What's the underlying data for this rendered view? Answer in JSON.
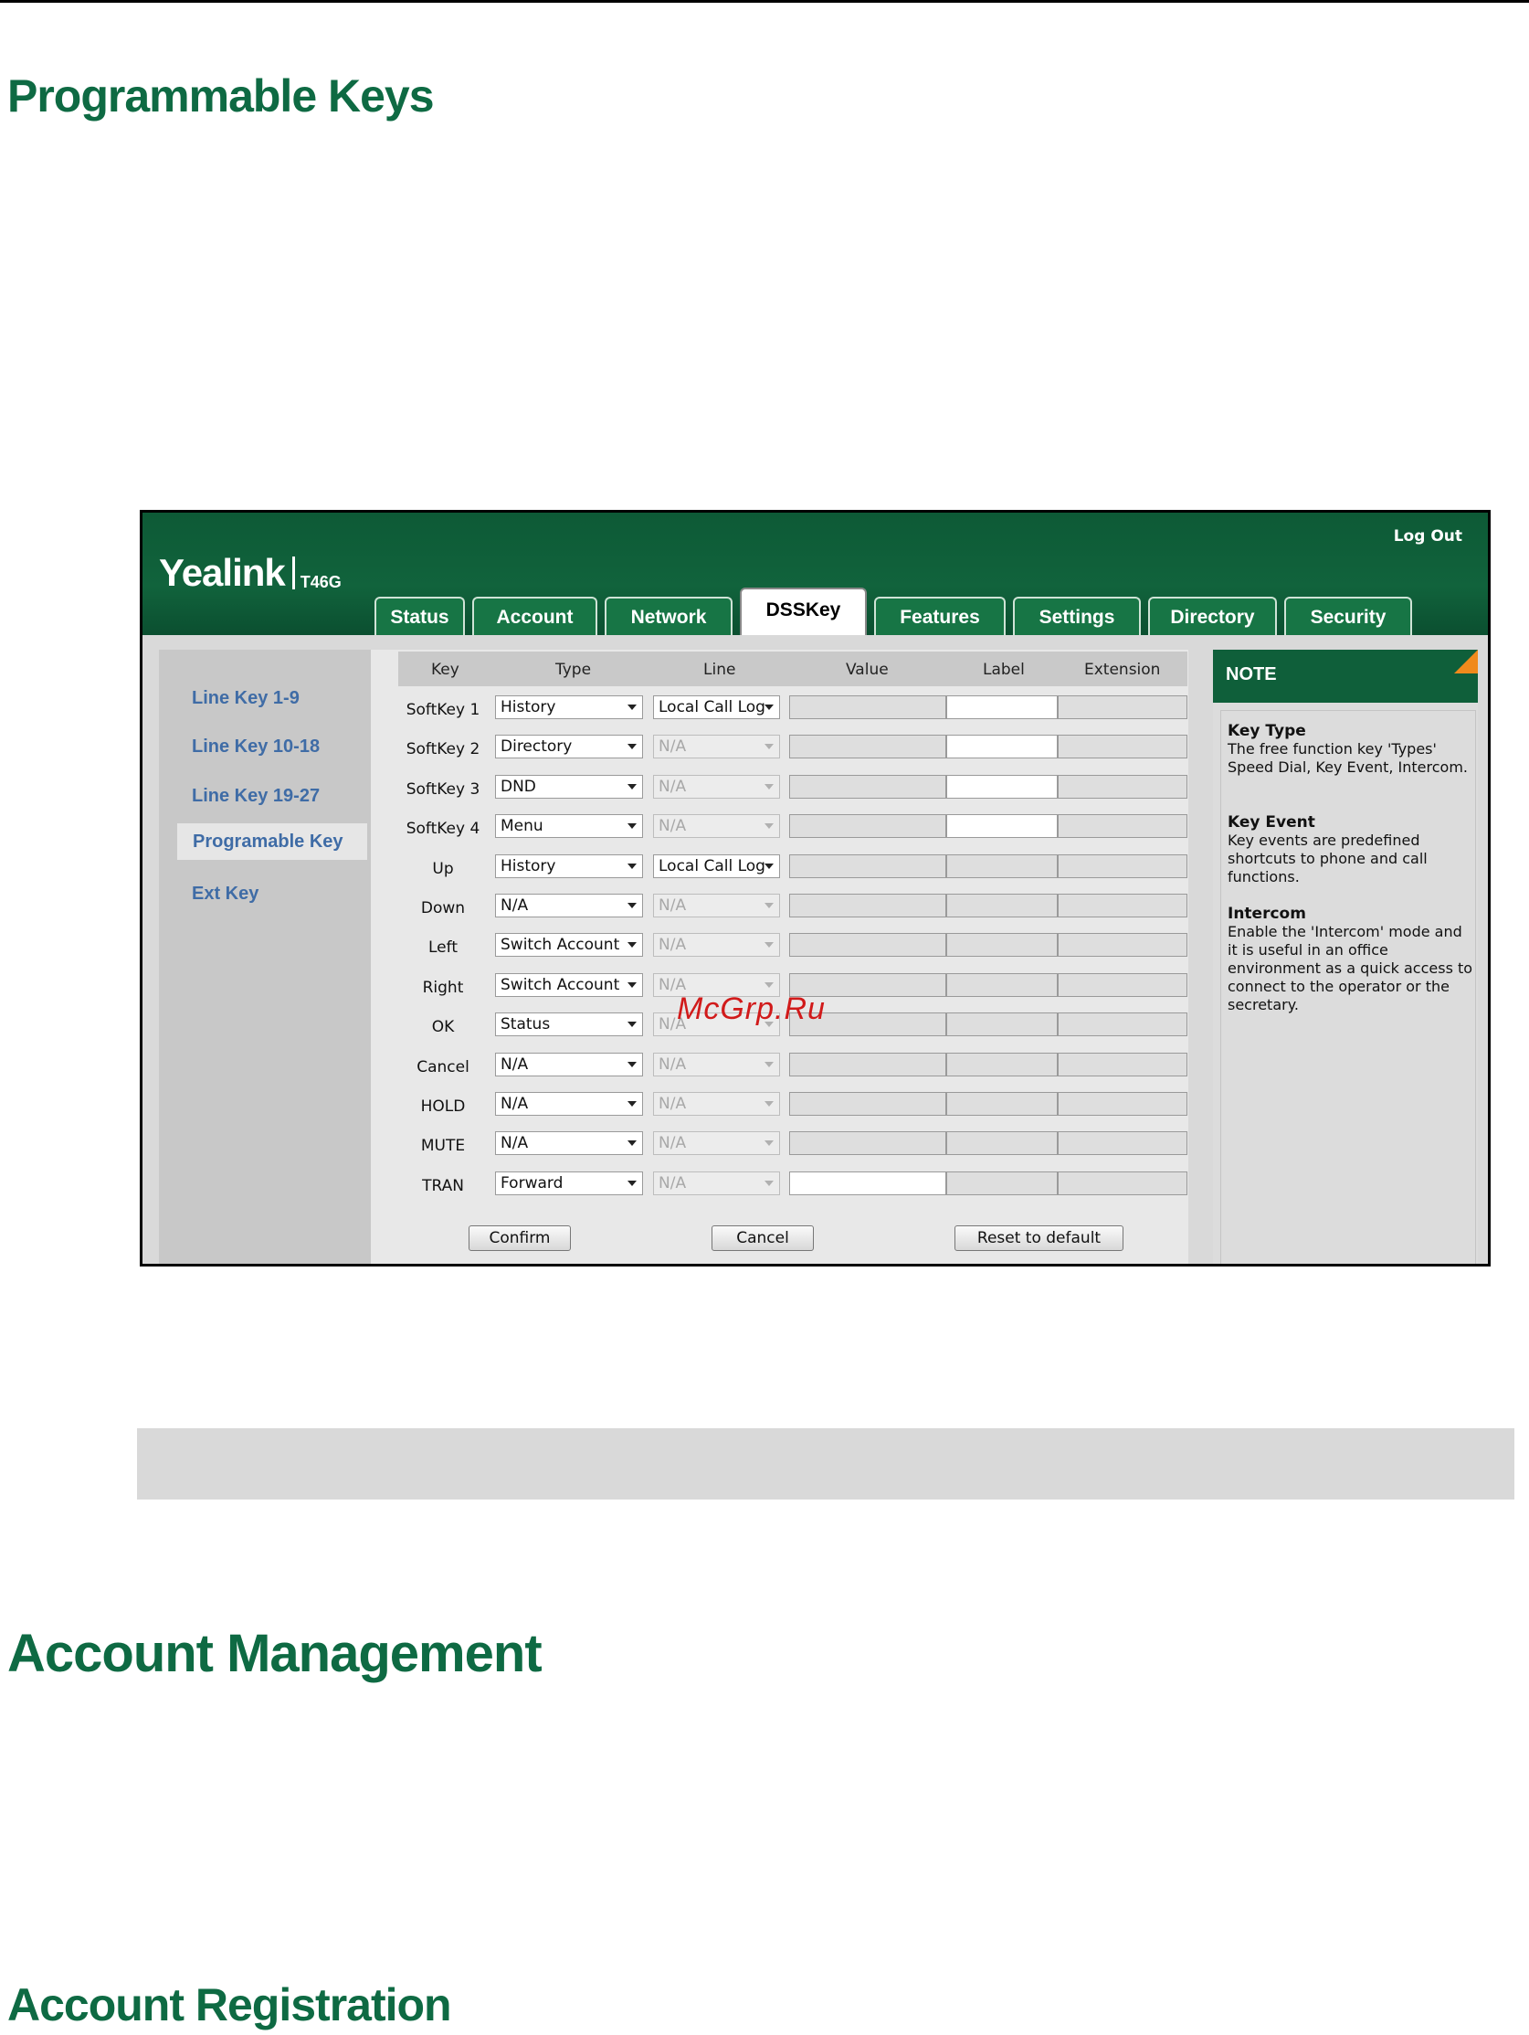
{
  "headings": {
    "programmable_keys": "Programmable Keys",
    "account_management": "Account Management",
    "account_registration": "Account Registration"
  },
  "app": {
    "logo": "Yealink",
    "model": "T46G",
    "logout": "Log Out",
    "tabs": [
      "Status",
      "Account",
      "Network",
      "DSSKey",
      "Features",
      "Settings",
      "Directory",
      "Security"
    ],
    "active_tab": "DSSKey"
  },
  "sidebar": {
    "items": [
      "Line Key 1-9",
      "Line Key 10-18",
      "Line Key 19-27",
      "Programable Key",
      "Ext Key"
    ],
    "active": "Programable Key"
  },
  "table": {
    "columns": [
      "Key",
      "Type",
      "Line",
      "Value",
      "Label",
      "Extension"
    ],
    "rows": [
      {
        "key": "SoftKey 1",
        "type": "History",
        "line": "Local Call Log",
        "line_enabled": true,
        "label_editable": true,
        "value_editable": false
      },
      {
        "key": "SoftKey 2",
        "type": "Directory",
        "line": "N/A",
        "line_enabled": false,
        "label_editable": true,
        "value_editable": false
      },
      {
        "key": "SoftKey 3",
        "type": "DND",
        "line": "N/A",
        "line_enabled": false,
        "label_editable": true,
        "value_editable": false
      },
      {
        "key": "SoftKey 4",
        "type": "Menu",
        "line": "N/A",
        "line_enabled": false,
        "label_editable": true,
        "value_editable": false
      },
      {
        "key": "Up",
        "type": "History",
        "line": "Local Call Log",
        "line_enabled": true,
        "label_editable": false,
        "value_editable": false
      },
      {
        "key": "Down",
        "type": "N/A",
        "line": "N/A",
        "line_enabled": false,
        "label_editable": false,
        "value_editable": false
      },
      {
        "key": "Left",
        "type": "Switch Account",
        "line": "N/A",
        "line_enabled": false,
        "label_editable": false,
        "value_editable": false
      },
      {
        "key": "Right",
        "type": "Switch Account",
        "line": "N/A",
        "line_enabled": false,
        "label_editable": false,
        "value_editable": false
      },
      {
        "key": "OK",
        "type": "Status",
        "line": "N/A",
        "line_enabled": false,
        "label_editable": false,
        "value_editable": false
      },
      {
        "key": "Cancel",
        "type": "N/A",
        "line": "N/A",
        "line_enabled": false,
        "label_editable": false,
        "value_editable": false
      },
      {
        "key": "HOLD",
        "type": "N/A",
        "line": "N/A",
        "line_enabled": false,
        "label_editable": false,
        "value_editable": false
      },
      {
        "key": "MUTE",
        "type": "N/A",
        "line": "N/A",
        "line_enabled": false,
        "label_editable": false,
        "value_editable": false
      },
      {
        "key": "TRAN",
        "type": "Forward",
        "line": "N/A",
        "line_enabled": false,
        "label_editable": false,
        "value_editable": true
      }
    ]
  },
  "buttons": {
    "confirm": "Confirm",
    "cancel": "Cancel",
    "reset": "Reset to default"
  },
  "note": {
    "title": "NOTE",
    "sections": [
      {
        "title": "Key Type",
        "text": "The free function key 'Types' Speed Dial, Key Event, Intercom."
      },
      {
        "title": "Key Event",
        "text": "Key events are predefined shortcuts to phone and call functions."
      },
      {
        "title": "Intercom",
        "text": "Enable the 'Intercom' mode and it is useful in an office environment as a quick access to connect to the operator or the secretary."
      }
    ]
  },
  "watermark": "McGrp.Ru",
  "colors": {
    "heading": "#0e6a43",
    "header_green": "#11633c",
    "note_corner": "#f08a1c",
    "sidebar_link": "#3f6ca6"
  }
}
